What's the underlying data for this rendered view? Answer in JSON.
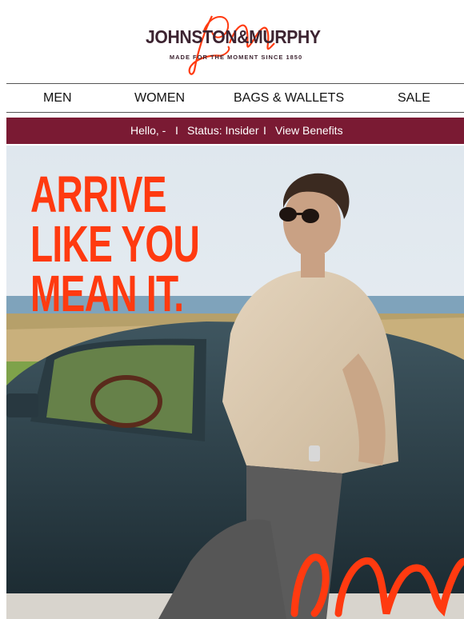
{
  "brand": {
    "wordmark": "JOHNSTON&MURPHY",
    "tagline": "MADE FOR THE MOMENT SINCE 1850",
    "colors": {
      "wordmark": "#3d2431",
      "script": "#ff3a10",
      "bar": "#7a1a33"
    }
  },
  "nav": {
    "items": [
      {
        "label": "MEN"
      },
      {
        "label": "WOMEN"
      },
      {
        "label": "BAGS & WALLETS"
      },
      {
        "label": "SALE"
      }
    ]
  },
  "status_bar": {
    "greeting": "Hello, -",
    "separator_1": "I",
    "status": "Status: Insider",
    "separator_2": "I",
    "benefits_link": "View Benefits"
  },
  "hero": {
    "headline": [
      "ARRIVE",
      "LIKE YOU",
      "MEAN IT."
    ]
  }
}
